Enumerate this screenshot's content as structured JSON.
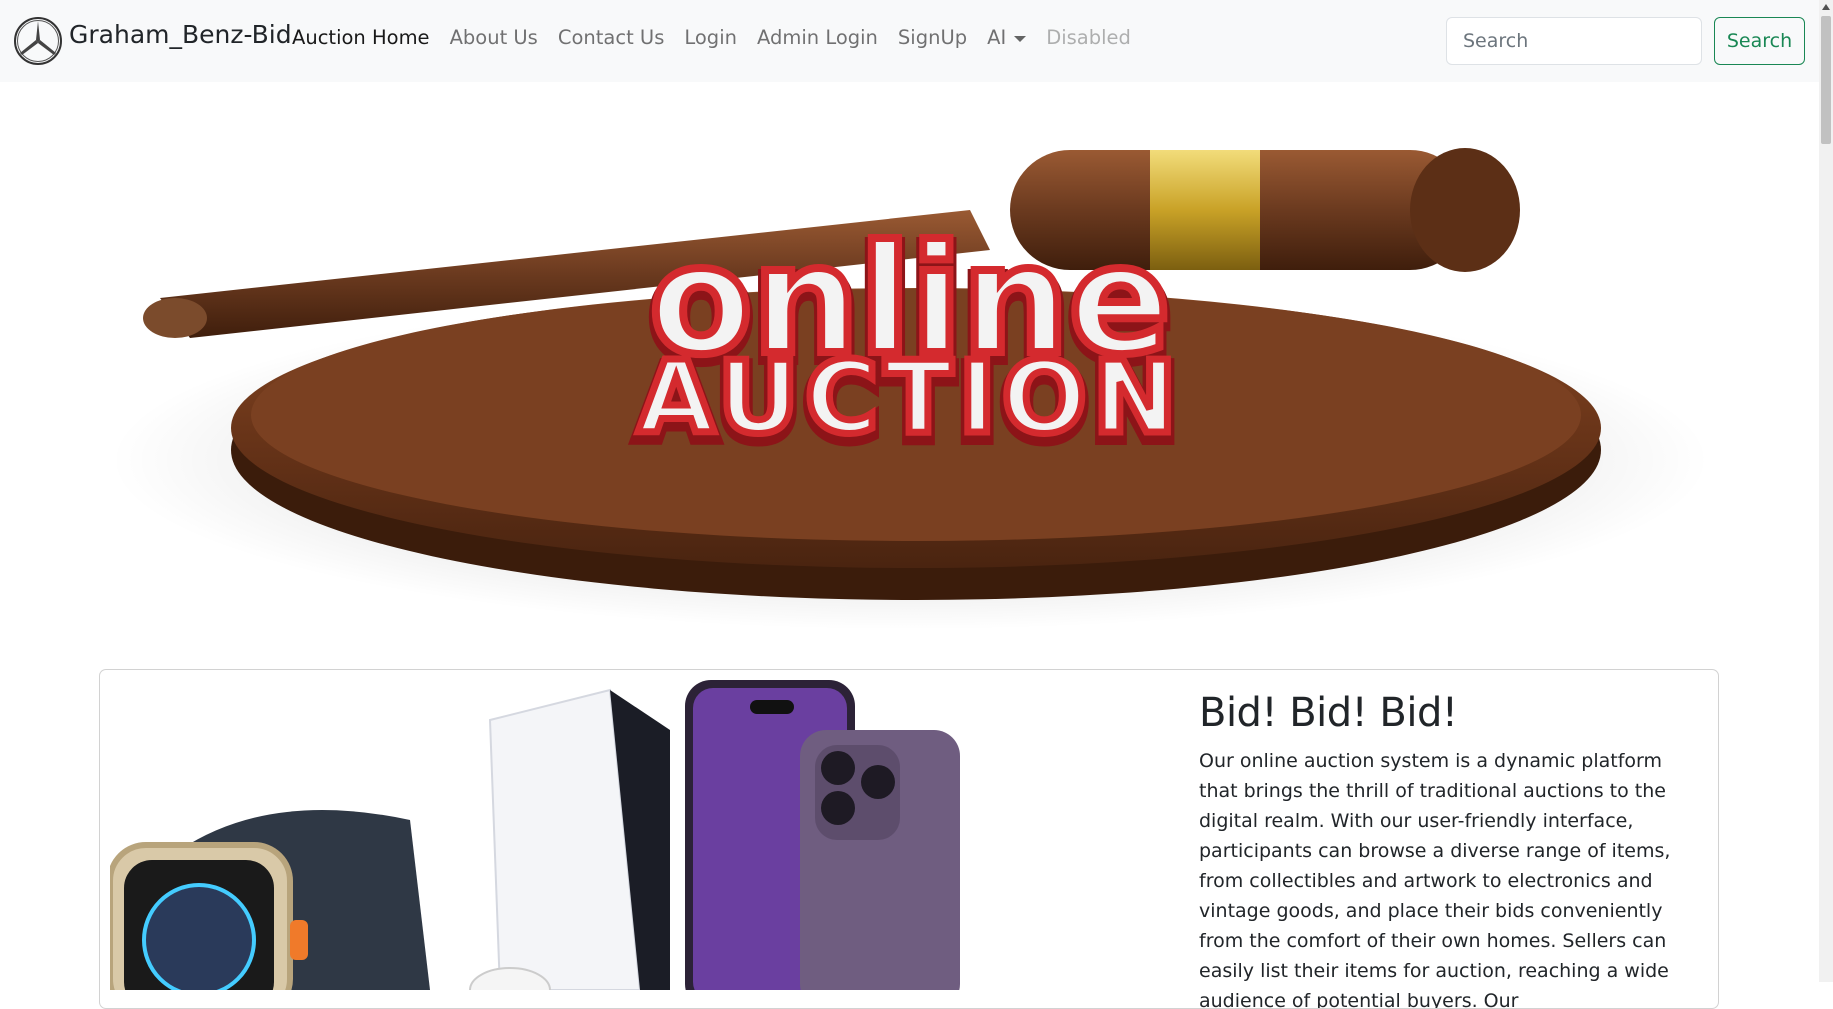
{
  "brand": {
    "name": "Graham_Benz-Bid",
    "logo_icon": "mercedes-star-icon"
  },
  "nav": {
    "links": [
      {
        "label": "Auction Home",
        "state": "active"
      },
      {
        "label": "About Us",
        "state": "normal"
      },
      {
        "label": "Contact Us",
        "state": "normal"
      },
      {
        "label": "Login",
        "state": "normal"
      },
      {
        "label": "Admin Login",
        "state": "normal"
      },
      {
        "label": "SignUp",
        "state": "normal"
      },
      {
        "label": "AI",
        "state": "dropdown"
      },
      {
        "label": "Disabled",
        "state": "disabled"
      }
    ]
  },
  "search": {
    "placeholder": "Search",
    "button_label": "Search"
  },
  "hero": {
    "line1": "online",
    "line2": "AUCTION"
  },
  "card": {
    "title": "Bid! Bid! Bid!",
    "text": "Our online auction system is a dynamic platform that brings the thrill of traditional auctions to the digital realm. With our user-friendly interface, participants can browse a diverse range of items, from collectibles and artwork to electronics and vintage goods, and place their bids conveniently from the comfort of their own homes. Sellers can easily list their items for auction, reaching a wide audience of potential buyers. Our"
  },
  "colors": {
    "navbar_bg": "#f8f9fa",
    "accent_green": "#198754",
    "hero_red": "#d42a2e",
    "wood": "#6b3a1f",
    "gold": "#c9a227"
  }
}
